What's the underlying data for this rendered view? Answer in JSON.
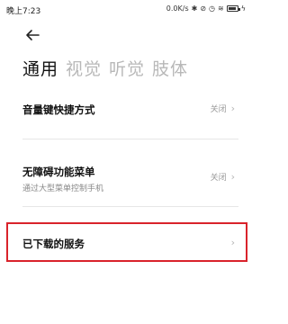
{
  "status": {
    "time": "晚上7:23",
    "network_speed": "0.0K/s",
    "icons": [
      "bluetooth-icon",
      "mute-icon",
      "alarm-icon",
      "wifi-icon",
      "battery-icon",
      "charging-icon"
    ]
  },
  "header": {
    "back_icon": "back-arrow-icon"
  },
  "tabs": [
    {
      "label": "通用",
      "active": true
    },
    {
      "label": "视觉",
      "active": false
    },
    {
      "label": "听觉",
      "active": false
    },
    {
      "label": "肢体",
      "active": false
    }
  ],
  "items": [
    {
      "title": "音量键快捷方式",
      "subtitle": "",
      "value": "关闭"
    },
    {
      "title": "无障碍功能菜单",
      "subtitle": "通过大型菜单控制手机",
      "value": "关闭"
    },
    {
      "title": "已下载的服务",
      "subtitle": "",
      "value": ""
    }
  ],
  "colors": {
    "accent_highlight": "#d9232b",
    "inactive_tab": "#b8b8b8"
  }
}
